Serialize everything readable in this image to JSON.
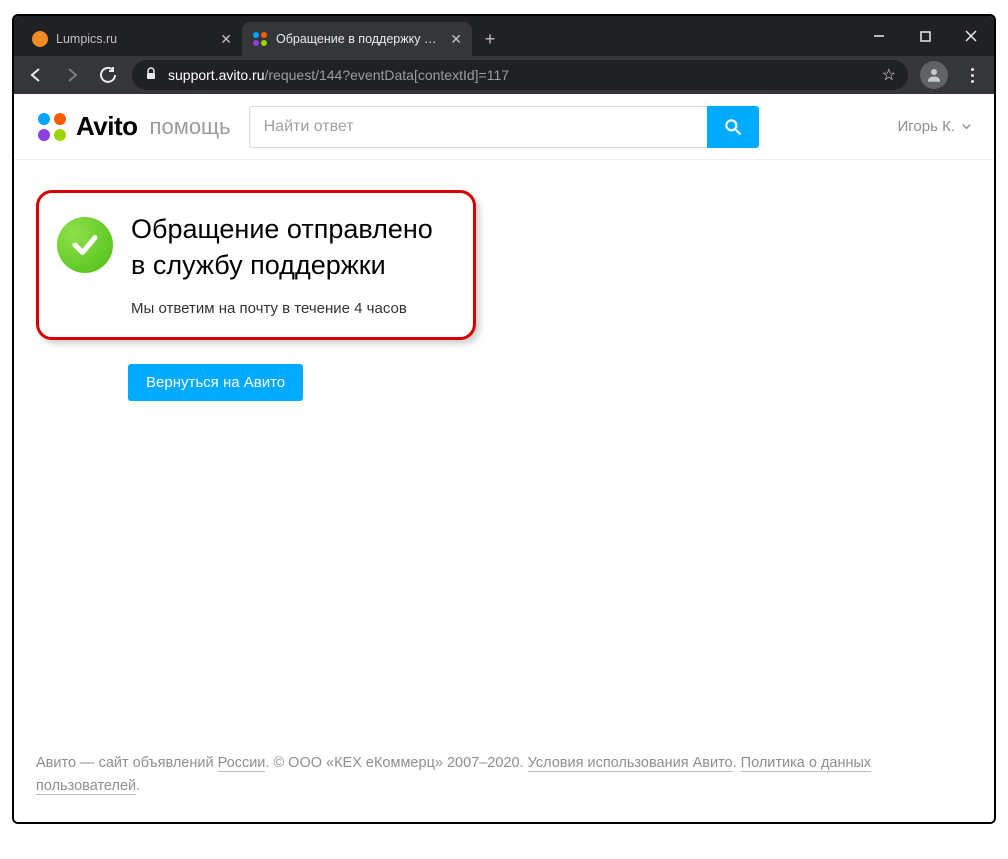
{
  "browser": {
    "tabs": [
      {
        "title": "Lumpics.ru",
        "active": false
      },
      {
        "title": "Обращение в поддержку Авито",
        "active": true
      }
    ],
    "url_host": "support.avito.ru",
    "url_path": "/request/144?eventData[contextId]=117"
  },
  "header": {
    "brand": "Avito",
    "brand_sub": "помощь",
    "search_placeholder": "Найти ответ",
    "user_name": "Игорь К."
  },
  "callout": {
    "title_line1": "Обращение отправлено",
    "title_line2": "в службу поддержки",
    "subtitle": "Мы ответим на почту в течение 4 часов"
  },
  "actions": {
    "return_label": "Вернуться на Авито"
  },
  "footer": {
    "t1": "Авито — сайт объявлений ",
    "russia": "России",
    "t2": ". © ООО «КЕХ еКоммерц» 2007–2020. ",
    "terms": "Условия использования Авито",
    "t3": ". ",
    "privacy": "Политика о данных пользователей",
    "t4": "."
  }
}
